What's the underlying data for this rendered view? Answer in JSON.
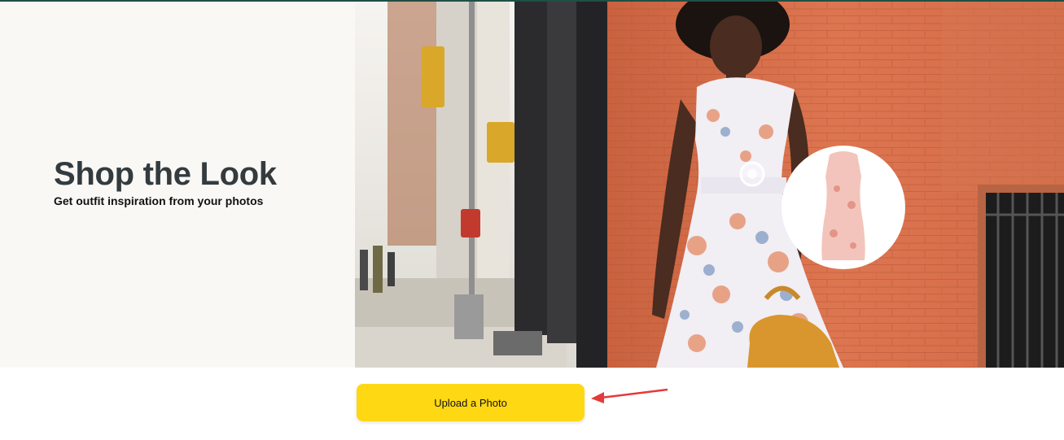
{
  "hero": {
    "title": "Shop the Look",
    "subtitle": "Get outfit inspiration from your photos"
  },
  "upload_button": {
    "label": "Upload a Photo"
  },
  "colors": {
    "button": "#ffd814",
    "left_panel": "#f9f8f5",
    "brick": "#d9714f",
    "annotation_arrow": "#e43a3a"
  }
}
